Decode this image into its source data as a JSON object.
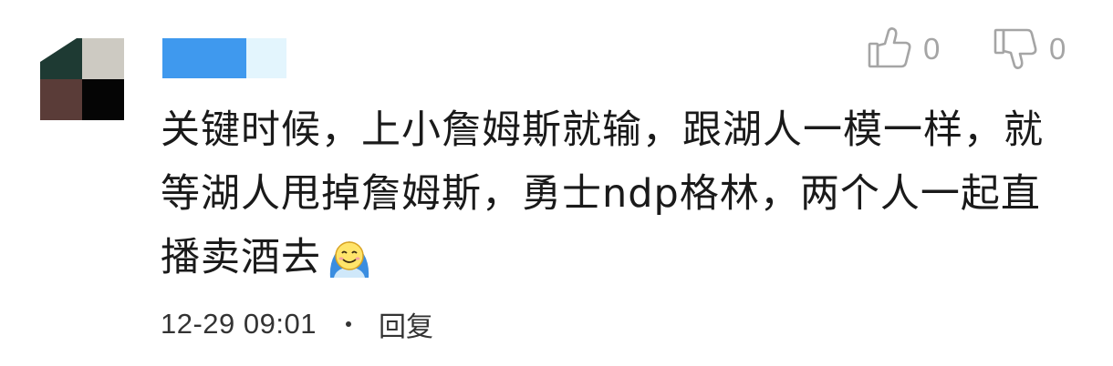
{
  "comment": {
    "author_name": "",
    "like_count": "0",
    "dislike_count": "0",
    "text": "关键时候，上小詹姆斯就输，跟湖人一模一样，就等湖人甩掉詹姆斯，勇士ndp格林，两个人一起直播卖酒去",
    "emoji_icon": "smiley-blanket-emoji-icon",
    "timestamp": "12-29 09:01",
    "reply_label": "回复"
  },
  "colors": {
    "username_primary": "#3f99ee",
    "username_secondary": "#e3f5fd",
    "icon_gray": "#a5a5a5",
    "text": "#1a1a1a"
  }
}
